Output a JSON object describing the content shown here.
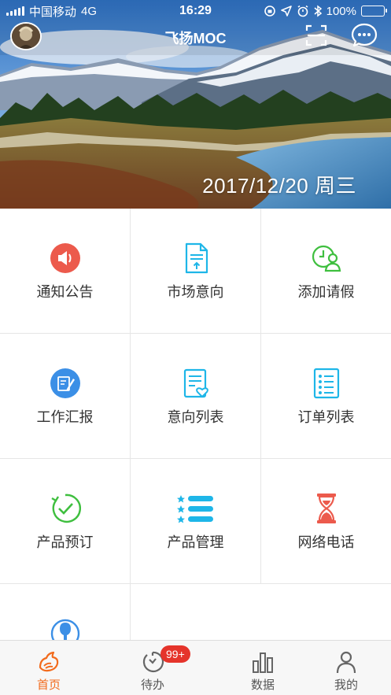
{
  "status_bar": {
    "carrier": "中国移动",
    "network": "4G",
    "time": "16:29",
    "battery": "100%",
    "battery_level": 1.0,
    "icons": [
      "orientation-lock-icon",
      "location-icon",
      "alarm-icon",
      "bluetooth-icon"
    ]
  },
  "header": {
    "title": "飞扬MOC",
    "date": "2017/12/20 周三"
  },
  "grid": {
    "items": [
      {
        "label": "通知公告",
        "icon": "megaphone-icon",
        "color": "#ec5a4c"
      },
      {
        "label": "市场意向",
        "icon": "document-icon",
        "color": "#1eb6e8"
      },
      {
        "label": "添加请假",
        "icon": "clock-person-icon",
        "color": "#3fbf3f"
      },
      {
        "label": "工作汇报",
        "icon": "edit-report-icon",
        "color": "#3b8fe6"
      },
      {
        "label": "意向列表",
        "icon": "list-heart-icon",
        "color": "#1eb6e8"
      },
      {
        "label": "订单列表",
        "icon": "checklist-icon",
        "color": "#1eb6e8"
      },
      {
        "label": "产品预订",
        "icon": "check-circle-icon",
        "color": "#3fbf3f"
      },
      {
        "label": "产品管理",
        "icon": "star-list-icon",
        "color": "#1eb6e8"
      },
      {
        "label": "网络电话",
        "icon": "hourglass-icon",
        "color": "#ec5a4c"
      },
      {
        "label": "",
        "icon": "user-badge-icon",
        "color": "#3b8fe6"
      }
    ]
  },
  "tabbar": {
    "tabs": [
      {
        "label": "首页",
        "icon": "home-bird-icon",
        "active": true
      },
      {
        "label": "待办",
        "icon": "timer-icon",
        "badge": "99+"
      },
      {
        "label": "数据",
        "icon": "bar-chart-icon"
      },
      {
        "label": "我的",
        "icon": "person-icon"
      }
    ],
    "active_color": "#f26b1d",
    "badge_color": "#e5342b"
  }
}
